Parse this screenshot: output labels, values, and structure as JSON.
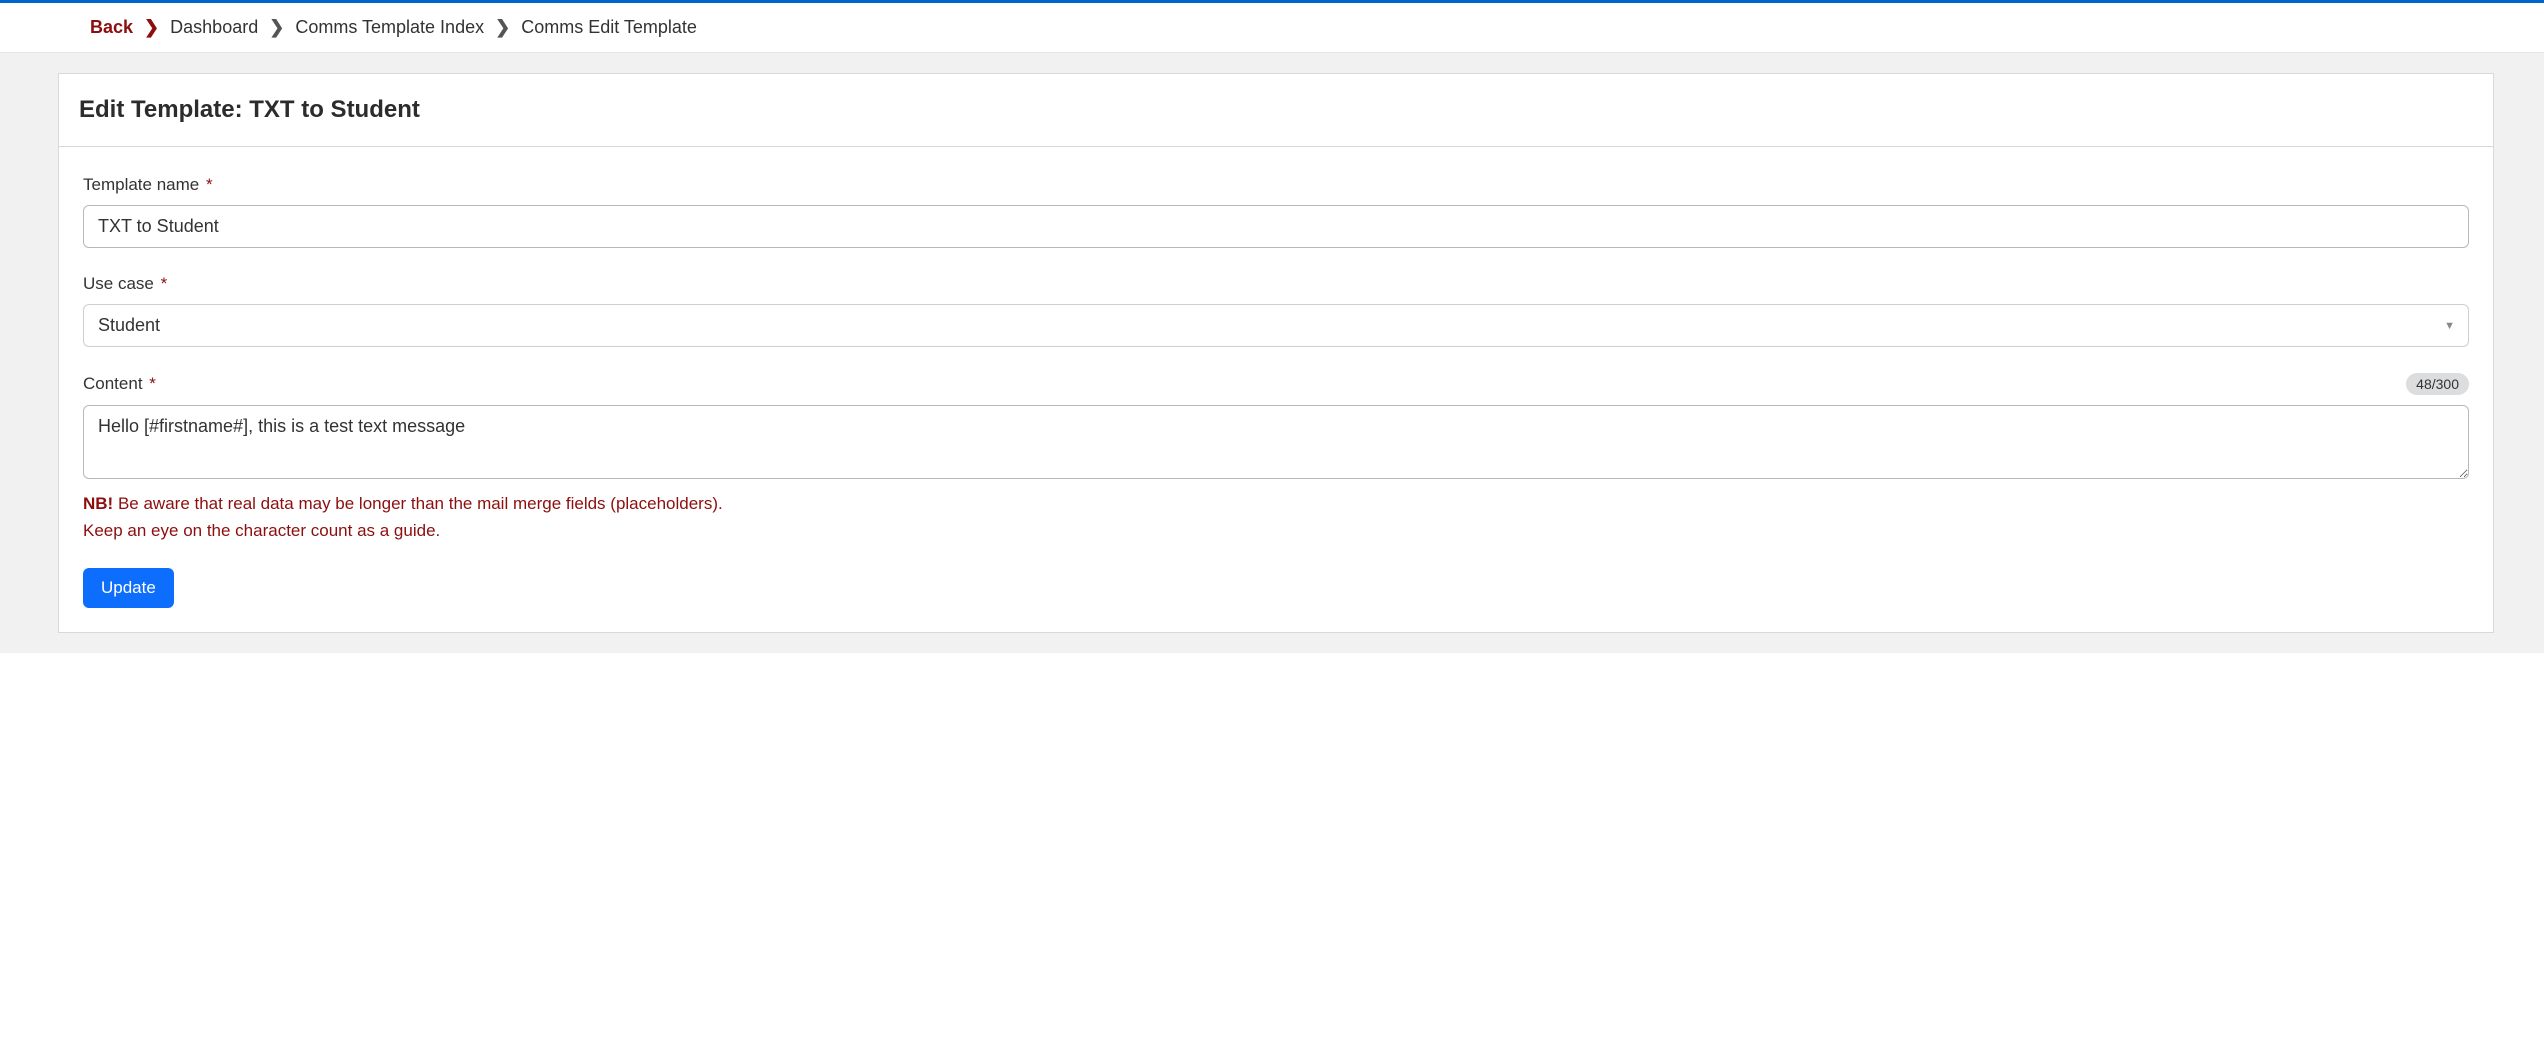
{
  "breadcrumb": {
    "back": "Back",
    "items": [
      "Dashboard",
      "Comms Template Index",
      "Comms Edit Template"
    ]
  },
  "page": {
    "title": "Edit Template: TXT to Student"
  },
  "form": {
    "template_name": {
      "label": "Template name",
      "value": "TXT to Student"
    },
    "use_case": {
      "label": "Use case",
      "value": "Student"
    },
    "content": {
      "label": "Content",
      "counter": "48/300",
      "value": "Hello [#firstname#], this is a test text message"
    },
    "warning": {
      "nb": "NB!",
      "line1": "Be aware that real data may be longer than the mail merge fields (placeholders).",
      "line2": "Keep an eye on the character count as a guide."
    },
    "submit_label": "Update"
  }
}
